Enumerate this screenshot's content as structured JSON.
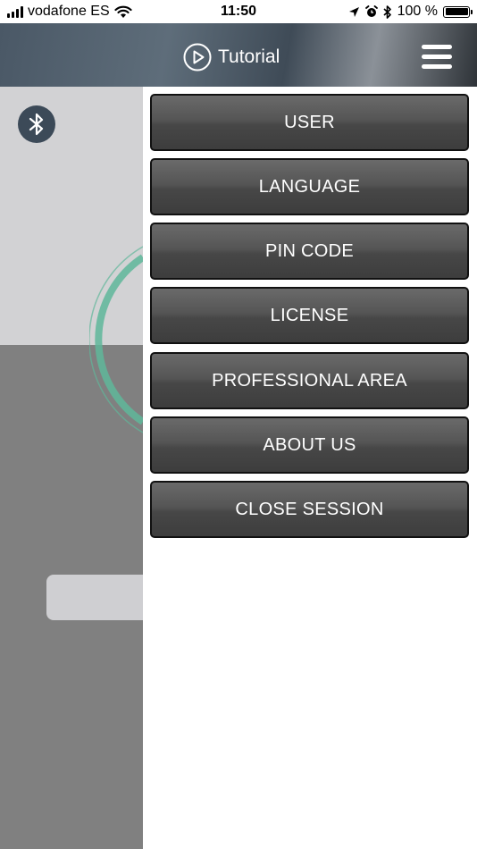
{
  "status_bar": {
    "carrier": "vodafone ES",
    "time": "11:50",
    "battery_text": "100 %",
    "icons": [
      "signal-bars-icon",
      "wifi-icon",
      "location-arrow-icon",
      "alarm-icon",
      "bluetooth-icon",
      "battery-icon"
    ]
  },
  "header": {
    "tutorial_label": "Tutorial",
    "tutorial_icon": "play-circle-icon",
    "menu_icon": "hamburger-menu-icon"
  },
  "background": {
    "bluetooth_icon": "bluetooth-icon",
    "accent_color": "#5fb79a"
  },
  "menu": {
    "items": [
      {
        "label": "USER"
      },
      {
        "label": "LANGUAGE"
      },
      {
        "label": "PIN CODE"
      },
      {
        "label": "LICENSE"
      },
      {
        "label": "PROFESSIONAL AREA"
      },
      {
        "label": "ABOUT US"
      },
      {
        "label": "CLOSE SESSION"
      }
    ]
  }
}
